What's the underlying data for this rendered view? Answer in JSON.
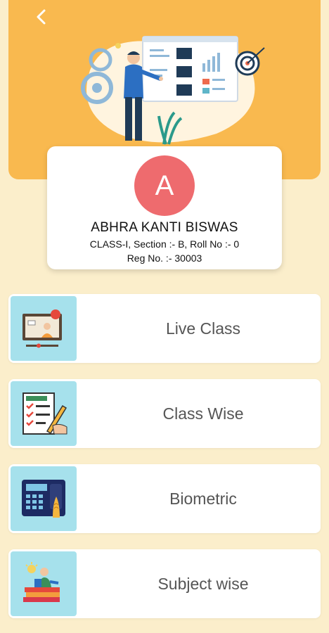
{
  "header": {
    "back_icon": "chevron-left-icon",
    "illustration": "presentation-illustration",
    "color": "#f9b94f"
  },
  "profile": {
    "avatar_letter": "A",
    "avatar_color": "#ee6b6e",
    "name": "ABHRA KANTI BISWAS",
    "class_line": "CLASS-I,  Section :- B, Roll No :- 0",
    "reg_line": "Reg No. :- 30003"
  },
  "menu": {
    "items": [
      {
        "label": "Live Class",
        "icon": "live-class-icon"
      },
      {
        "label": "Class Wise",
        "icon": "checklist-icon"
      },
      {
        "label": "Biometric",
        "icon": "biometric-device-icon"
      },
      {
        "label": "Subject wise",
        "icon": "books-student-icon"
      }
    ],
    "icon_bg": "#a6e1ec"
  },
  "background": "#fbeecb"
}
